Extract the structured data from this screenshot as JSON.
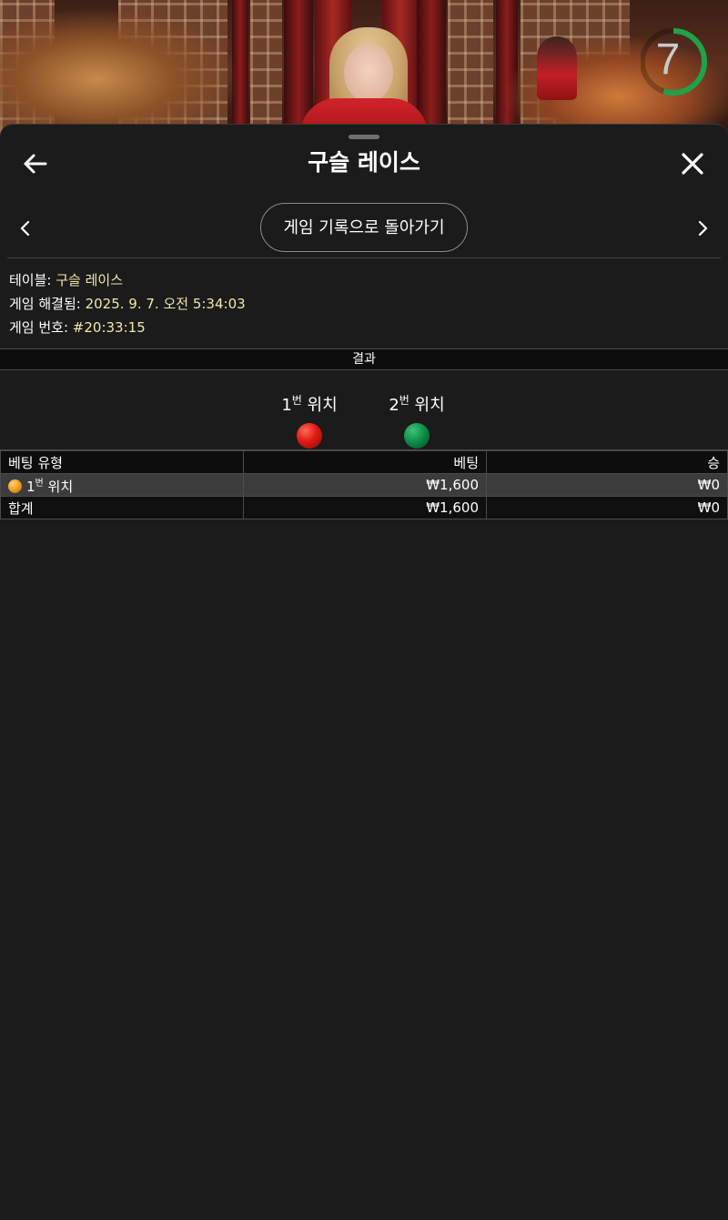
{
  "video": {
    "countdown": "7",
    "countdown_progress": 0.55,
    "countdown_color": "#1fa24a"
  },
  "header": {
    "title": "구슬 레이스"
  },
  "nav": {
    "back_history_label": "게임 기록으로 돌아가기"
  },
  "info": {
    "table_label": "테이블: ",
    "table_value": "구슬 레이스",
    "resolved_label": "게임 해결됨: ",
    "resolved_value": "2025. 9. 7. 오전 5:34:03",
    "game_no_label": "게임 번호: ",
    "game_no_value": "#20:33:15"
  },
  "result": {
    "section_title": "결과",
    "positions": [
      {
        "num": "1",
        "sup": "번",
        "label": " 위치",
        "ball_color": "#e01a12"
      },
      {
        "num": "2",
        "sup": "번",
        "label": " 위치",
        "ball_color": "#0d8a45"
      }
    ]
  },
  "bets_table": {
    "headers": [
      "베팅 유형",
      "베팅",
      "승"
    ],
    "rows": [
      {
        "type_num": "1",
        "type_sup": "번",
        "type_label": " 위치",
        "bet": "₩1,600",
        "win": "₩0"
      }
    ],
    "total": {
      "label": "합계",
      "bet": "₩1,600",
      "win": "₩0"
    }
  },
  "colors": {
    "accent_value": "#f3e7a6",
    "background": "#1b1b1b"
  }
}
